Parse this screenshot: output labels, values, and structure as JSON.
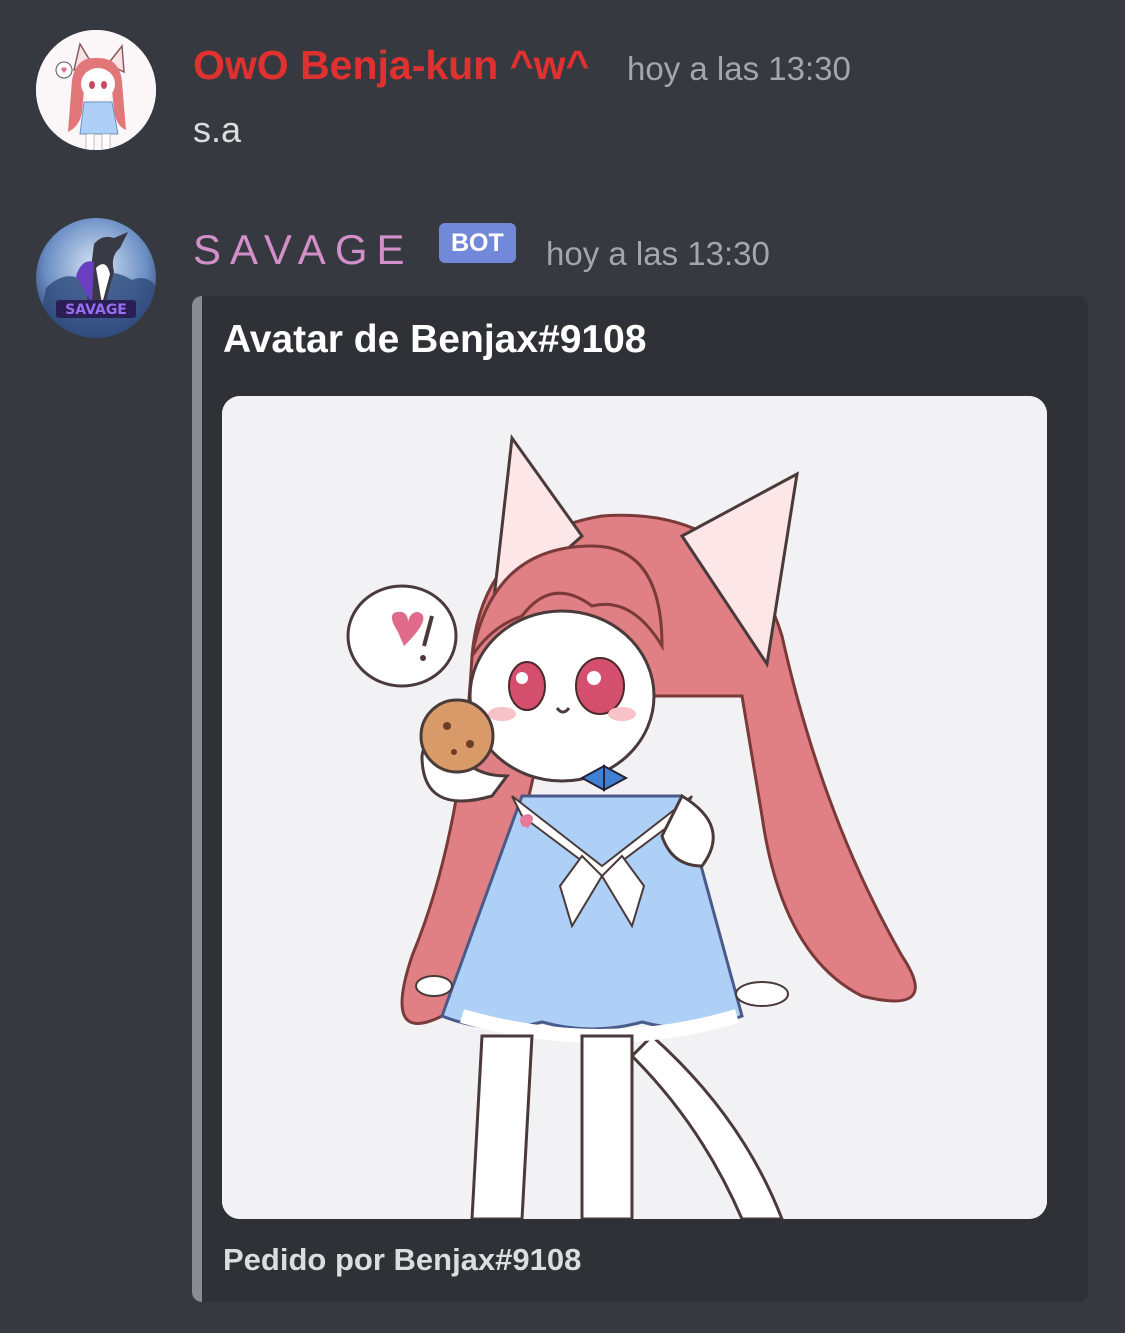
{
  "messages": [
    {
      "username": "OwO Benja-kun ^w^",
      "username_color": "#e03131",
      "timestamp": "hoy a las 13:30",
      "content": "s.a",
      "avatar": "anime-catgirl-avatar"
    },
    {
      "username": "SAVAGE",
      "username_color": "#d38fc9",
      "badge": "BOT",
      "timestamp": "hoy a las 13:30",
      "avatar": "wolf-savage-logo-avatar",
      "avatar_text": "SAVAGE",
      "embed": {
        "title": "Avatar de Benjax#9108",
        "image": "catgirl-with-cookie-illustration",
        "footer": "Pedido por Benjax#9108",
        "accent_color": "#8a8c91"
      }
    }
  ]
}
